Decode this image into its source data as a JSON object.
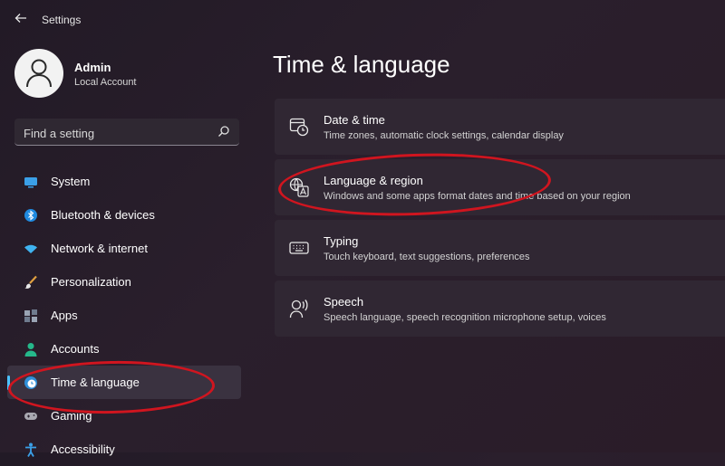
{
  "app": {
    "title": "Settings"
  },
  "profile": {
    "name": "Admin",
    "account_type": "Local Account"
  },
  "search": {
    "placeholder": "Find a setting"
  },
  "sidebar": {
    "items": [
      {
        "label": "System",
        "icon": "monitor-icon"
      },
      {
        "label": "Bluetooth & devices",
        "icon": "bluetooth-icon"
      },
      {
        "label": "Network & internet",
        "icon": "wifi-icon"
      },
      {
        "label": "Personalization",
        "icon": "brush-icon"
      },
      {
        "label": "Apps",
        "icon": "apps-icon"
      },
      {
        "label": "Accounts",
        "icon": "person-icon"
      },
      {
        "label": "Time & language",
        "icon": "clock-globe-icon",
        "selected": true
      },
      {
        "label": "Gaming",
        "icon": "gamepad-icon"
      },
      {
        "label": "Accessibility",
        "icon": "accessibility-icon"
      }
    ]
  },
  "main": {
    "title": "Time & language",
    "cards": [
      {
        "title": "Date & time",
        "description": "Time zones, automatic clock settings, calendar display",
        "icon": "calendar-clock-icon"
      },
      {
        "title": "Language & region",
        "description": "Windows and some apps format dates and time based on your region",
        "icon": "language-icon"
      },
      {
        "title": "Typing",
        "description": "Touch keyboard, text suggestions, preferences",
        "icon": "keyboard-icon"
      },
      {
        "title": "Speech",
        "description": "Speech language, speech recognition microphone setup, voices",
        "icon": "speech-icon"
      }
    ]
  },
  "colors": {
    "accent": "#4cc2ff",
    "annotation": "#d0151f",
    "background": "#221a26",
    "card": "#302733"
  }
}
